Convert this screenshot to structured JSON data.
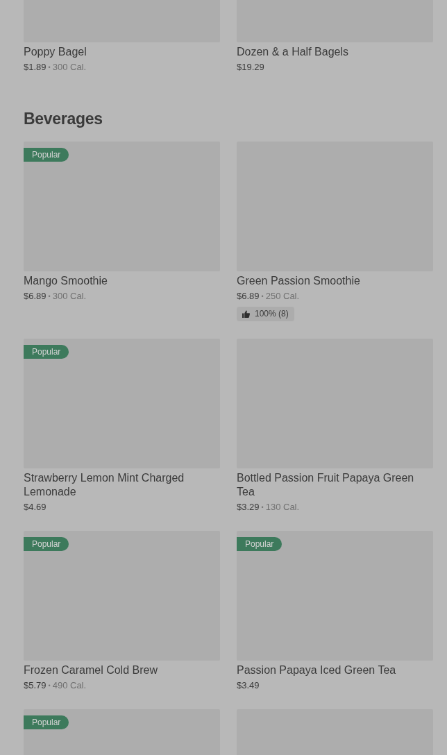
{
  "sections": [
    {
      "items": [
        {
          "name": "Poppy Bagel",
          "price": "$1.89",
          "separator": "•",
          "calories": "300 Cal."
        },
        {
          "name": "Dozen & a Half Bagels",
          "price": "$19.29"
        }
      ]
    },
    {
      "title": "Beverages",
      "items": [
        {
          "badge": "Popular",
          "name": "Mango Smoothie",
          "price": "$6.89",
          "separator": "•",
          "calories": "300 Cal.",
          "popular": true
        },
        {
          "name": "Green Passion Smoothie",
          "price": "$6.89",
          "separator": "•",
          "calories": "250 Cal.",
          "rating": "100% (8)",
          "popular": false
        },
        {
          "badge": "Popular",
          "name": "Strawberry Lemon Mint Charged Lemonade",
          "price": "$4.69",
          "popular": true
        },
        {
          "name": "Bottled Passion Fruit Papaya Green Tea",
          "price": "$3.29",
          "separator": "•",
          "calories": "130 Cal.",
          "popular": false
        },
        {
          "badge": "Popular",
          "name": "Frozen Caramel Cold Brew",
          "price": "$5.79",
          "separator": "•",
          "calories": "490 Cal.",
          "popular": true
        },
        {
          "badge": "Popular",
          "name": "Passion Papaya Iced Green Tea",
          "price": "$3.49",
          "popular": true
        },
        {
          "badge": "Popular",
          "popular": true
        },
        {
          "popular": false
        }
      ]
    }
  ]
}
